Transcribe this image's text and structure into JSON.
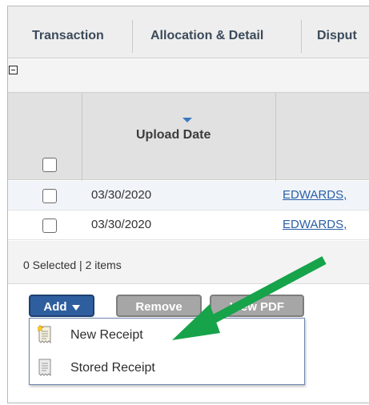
{
  "tabs": [
    "Transaction",
    "Allocation & Detail",
    "Disput"
  ],
  "table": {
    "column_header": "Upload Date",
    "rows": [
      {
        "date": "03/30/2020",
        "name": "EDWARDS,"
      },
      {
        "date": "03/30/2020",
        "name": "EDWARDS,"
      }
    ],
    "footer": "0 Selected | 2 items"
  },
  "buttons": {
    "add": "Add",
    "remove": "Remove",
    "pdf": "View PDF"
  },
  "add_menu": {
    "items": [
      {
        "label": "New Receipt",
        "icon": "new-receipt-icon"
      },
      {
        "label": "Stored Receipt",
        "icon": "stored-receipt-icon"
      }
    ]
  },
  "colors": {
    "accent_button": "#2f5e9e",
    "disabled_button": "#a6a6a6",
    "link": "#2a5fa6",
    "annotation_arrow": "#16a34a"
  }
}
